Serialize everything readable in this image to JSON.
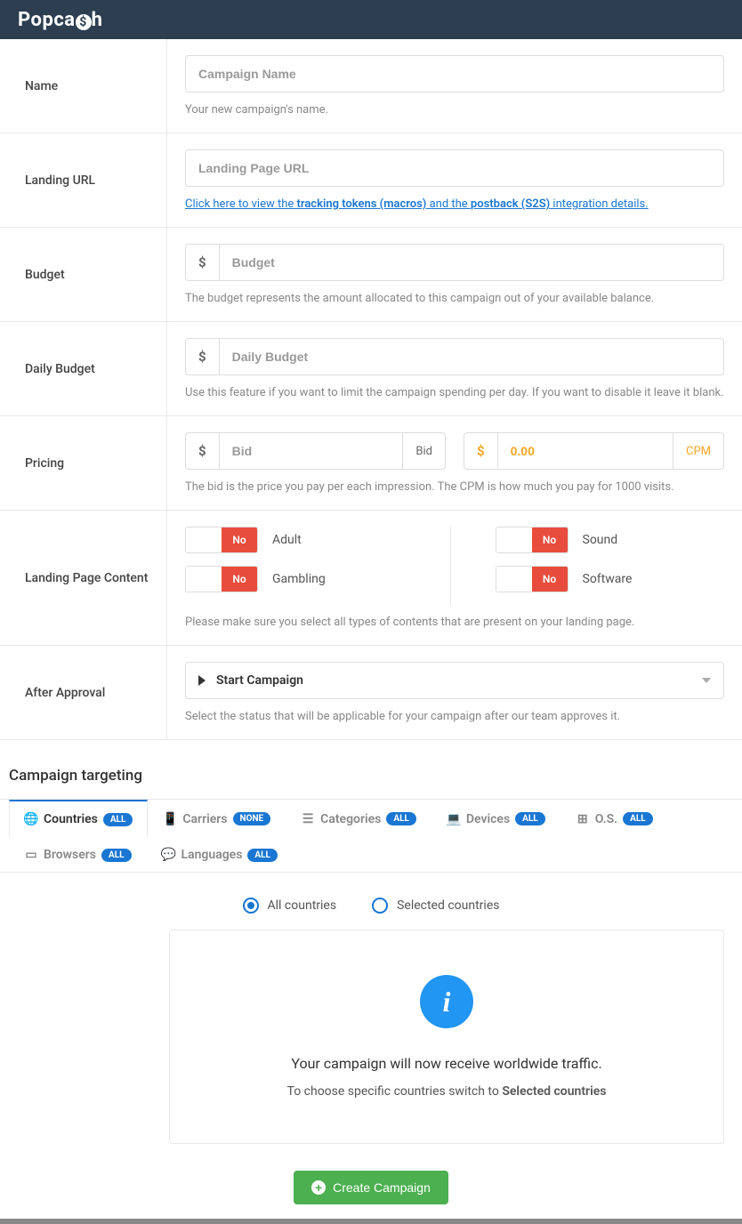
{
  "brand": "Popcash",
  "form": {
    "name": {
      "label": "Name",
      "placeholder": "Campaign Name",
      "helper": "Your new campaign's name."
    },
    "landing_url": {
      "label": "Landing URL",
      "placeholder": "Landing Page URL",
      "link_pre": "Click here to view the ",
      "link_tokens": "tracking tokens (macros)",
      "link_mid": " and the ",
      "link_postback": "postback (S2S)",
      "link_suf": " integration details."
    },
    "budget": {
      "label": "Budget",
      "prefix": "$",
      "placeholder": "Budget",
      "helper": "The budget represents the amount allocated to this campaign out of your available balance."
    },
    "daily_budget": {
      "label": "Daily Budget",
      "prefix": "$",
      "placeholder": "Daily Budget",
      "helper": "Use this feature if you want to limit the campaign spending per day. If you want to disable it leave it blank."
    },
    "pricing": {
      "label": "Pricing",
      "bid_prefix": "$",
      "bid_placeholder": "Bid",
      "bid_suffix": "Bid",
      "cpm_prefix": "$",
      "cpm_value": "0.00",
      "cpm_suffix": "CPM",
      "helper": "The bid is the price you pay per each impression. The CPM is how much you pay for 1000 visits."
    },
    "content": {
      "label": "Landing Page Content",
      "items": [
        {
          "name": "Adult",
          "value": "No"
        },
        {
          "name": "Sound",
          "value": "No"
        },
        {
          "name": "Gambling",
          "value": "No"
        },
        {
          "name": "Software",
          "value": "No"
        }
      ],
      "helper": "Please make sure you select all types of contents that are present on your landing page."
    },
    "after_approval": {
      "label": "After Approval",
      "selected": "Start Campaign",
      "helper": "Select the status that will be applicable for your campaign after our team approves it."
    }
  },
  "targeting": {
    "title": "Campaign targeting",
    "tabs": [
      {
        "label": "Countries",
        "badge": "ALL",
        "active": true
      },
      {
        "label": "Carriers",
        "badge": "NONE",
        "active": false
      },
      {
        "label": "Categories",
        "badge": "ALL",
        "active": false
      },
      {
        "label": "Devices",
        "badge": "ALL",
        "active": false
      },
      {
        "label": "O.S.",
        "badge": "ALL",
        "active": false
      },
      {
        "label": "Browsers",
        "badge": "ALL",
        "active": false
      },
      {
        "label": "Languages",
        "badge": "ALL",
        "active": false
      }
    ],
    "radio": {
      "all": "All countries",
      "selected": "Selected countries"
    },
    "panel": {
      "text": "Your campaign will now receive worldwide traffic.",
      "sub_pre": "To choose specific countries switch to ",
      "sub_bold": "Selected countries"
    }
  },
  "footer": {
    "create": "Create Campaign"
  }
}
